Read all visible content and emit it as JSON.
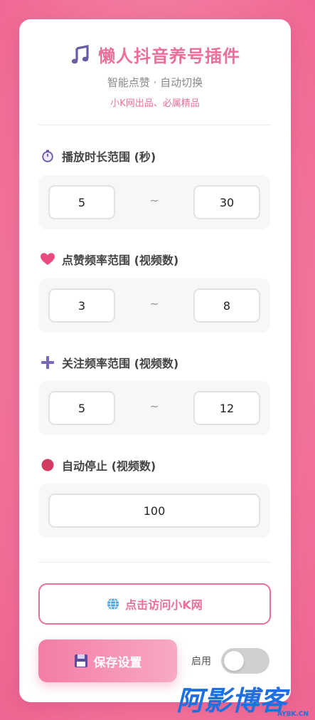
{
  "header": {
    "title_icon": "music-note-icon",
    "title": "懒人抖音养号插件",
    "subtitle": "智能点赞 · 自动切换",
    "credit": "小K网出品、必属精品"
  },
  "sections": {
    "play_duration": {
      "icon": "stopwatch-icon",
      "label": "播放时长范围 (秒)",
      "min": "5",
      "max": "30"
    },
    "like_frequency": {
      "icon": "heart-icon",
      "label": "点赞频率范围 (视频数)",
      "min": "3",
      "max": "8"
    },
    "follow_frequency": {
      "icon": "plus-icon",
      "label": "关注频率范围 (视频数)",
      "min": "5",
      "max": "12"
    },
    "auto_stop": {
      "icon": "red-circle-icon",
      "label": "自动停止 (视频数)",
      "value": "100"
    }
  },
  "range_separator": "~",
  "visit_button": {
    "icon": "globe-icon",
    "label": "点击访问小K网"
  },
  "save_button": {
    "icon": "floppy-disk-icon",
    "label": "保存设置"
  },
  "enable_toggle": {
    "label": "启用",
    "on": false
  },
  "watermark": {
    "text": "阿影博客",
    "sub": "AYBK.CN"
  },
  "colors": {
    "accent": "#ec6f9a",
    "background": "#f3799f",
    "toggle_off": "#d0d0d0"
  }
}
